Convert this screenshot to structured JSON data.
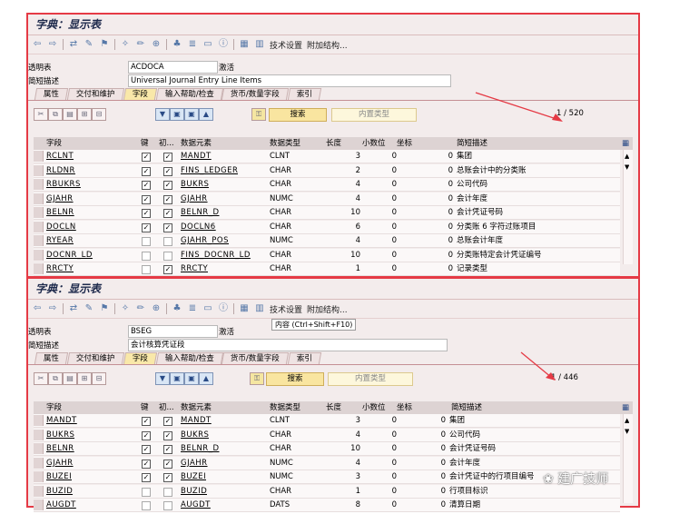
{
  "toolbar": {
    "tech_settings": "技术设置",
    "append_structure": "附加结构..."
  },
  "labels": {
    "transparent_table": "透明表",
    "short_desc": "简短描述",
    "status": "激活"
  },
  "tabs": [
    "属性",
    "交付和维护",
    "字段",
    "输入帮助/检查",
    "货币/数量字段",
    "索引"
  ],
  "active_tab": "字段",
  "grid_buttons": {
    "search": "搜索",
    "builtin_type": "内置类型"
  },
  "columns": [
    "字段",
    "键",
    "初...",
    "数据元素",
    "数据类型",
    "长度",
    "小数位",
    "坐标",
    "简短描述"
  ],
  "panel1": {
    "title": "字典：显示表",
    "table_name": "ACDOCA",
    "short_desc": "Universal Journal Entry Line Items",
    "pager": "1 / 520",
    "rows": [
      {
        "field": "RCLNT",
        "key": true,
        "init": true,
        "element": "MANDT",
        "type": "CLNT",
        "len": "3",
        "dec": "0",
        "coord": "0",
        "desc": "集团"
      },
      {
        "field": "RLDNR",
        "key": true,
        "init": true,
        "element": "FINS_LEDGER",
        "type": "CHAR",
        "len": "2",
        "dec": "0",
        "coord": "0",
        "desc": "总账会计中的分类账"
      },
      {
        "field": "RBUKRS",
        "key": true,
        "init": true,
        "element": "BUKRS",
        "type": "CHAR",
        "len": "4",
        "dec": "0",
        "coord": "0",
        "desc": "公司代码"
      },
      {
        "field": "GJAHR",
        "key": true,
        "init": true,
        "element": "GJAHR",
        "type": "NUMC",
        "len": "4",
        "dec": "0",
        "coord": "0",
        "desc": "会计年度"
      },
      {
        "field": "BELNR",
        "key": true,
        "init": true,
        "element": "BELNR_D",
        "type": "CHAR",
        "len": "10",
        "dec": "0",
        "coord": "0",
        "desc": "会计凭证号码"
      },
      {
        "field": "DOCLN",
        "key": true,
        "init": true,
        "element": "DOCLN6",
        "type": "CHAR",
        "len": "6",
        "dec": "0",
        "coord": "0",
        "desc": "分类账 6 字符过账项目"
      },
      {
        "field": "RYEAR",
        "key": false,
        "init": false,
        "element": "GJAHR_POS",
        "type": "NUMC",
        "len": "4",
        "dec": "0",
        "coord": "0",
        "desc": "总账会计年度"
      },
      {
        "field": "DOCNR_LD",
        "key": false,
        "init": false,
        "element": "FINS_DOCNR_LD",
        "type": "CHAR",
        "len": "10",
        "dec": "0",
        "coord": "0",
        "desc": "分类账特定会计凭证编号"
      },
      {
        "field": "RRCTY",
        "key": false,
        "init": true,
        "element": "RRCTY",
        "type": "CHAR",
        "len": "1",
        "dec": "0",
        "coord": "0",
        "desc": "记录类型"
      }
    ]
  },
  "panel2": {
    "title": "字典：显示表",
    "table_name": "BSEG",
    "short_desc": "会计核算凭证段",
    "tooltip": "内容 (Ctrl+Shift+F10)",
    "pager": "1 / 446",
    "rows": [
      {
        "field": "MANDT",
        "key": true,
        "init": true,
        "element": "MANDT",
        "type": "CLNT",
        "len": "3",
        "dec": "0",
        "coord": "0",
        "desc": "集团"
      },
      {
        "field": "BUKRS",
        "key": true,
        "init": true,
        "element": "BUKRS",
        "type": "CHAR",
        "len": "4",
        "dec": "0",
        "coord": "0",
        "desc": "公司代码"
      },
      {
        "field": "BELNR",
        "key": true,
        "init": true,
        "element": "BELNR_D",
        "type": "CHAR",
        "len": "10",
        "dec": "0",
        "coord": "0",
        "desc": "会计凭证号码"
      },
      {
        "field": "GJAHR",
        "key": true,
        "init": true,
        "element": "GJAHR",
        "type": "NUMC",
        "len": "4",
        "dec": "0",
        "coord": "0",
        "desc": "会计年度"
      },
      {
        "field": "BUZEI",
        "key": true,
        "init": true,
        "element": "BUZEI",
        "type": "NUMC",
        "len": "3",
        "dec": "0",
        "coord": "0",
        "desc": "会计凭证中的行项目编号"
      },
      {
        "field": "BUZID",
        "key": false,
        "init": false,
        "element": "BUZID",
        "type": "CHAR",
        "len": "1",
        "dec": "0",
        "coord": "0",
        "desc": "行项目标识"
      },
      {
        "field": "AUGDT",
        "key": false,
        "init": false,
        "element": "AUGDT",
        "type": "DATS",
        "len": "8",
        "dec": "0",
        "coord": "0",
        "desc": "清算日期"
      }
    ]
  },
  "watermark": "建广技师"
}
